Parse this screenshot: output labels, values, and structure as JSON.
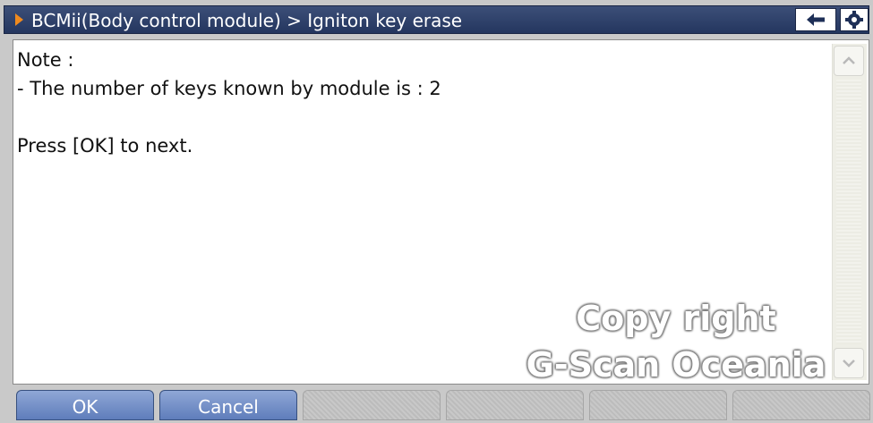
{
  "header": {
    "title": "BCMii(Body control module) > Igniton key erase",
    "arrow_icon": "play-arrow-icon",
    "arrow_color": "#f08a1e",
    "back_icon": "back-arrow-icon",
    "settings_icon": "gear-icon",
    "bar_color": "#2e4169"
  },
  "content": {
    "lines": [
      "Note :",
      "- The number of keys known by module is : 2",
      "",
      "Press [OK] to next."
    ]
  },
  "scrollbar": {
    "up_icon": "scroll-up-icon",
    "down_icon": "scroll-down-icon"
  },
  "footer": {
    "buttons": [
      {
        "label": "OK",
        "state": "active"
      },
      {
        "label": "Cancel",
        "state": "active"
      },
      {
        "label": "",
        "state": "disabled"
      },
      {
        "label": "",
        "state": "disabled"
      },
      {
        "label": "",
        "state": "disabled"
      },
      {
        "label": "",
        "state": "disabled"
      }
    ],
    "active_color": "#6f8ac5"
  },
  "watermark": {
    "line1": "Copy right",
    "line2": "G-Scan Oceania"
  }
}
